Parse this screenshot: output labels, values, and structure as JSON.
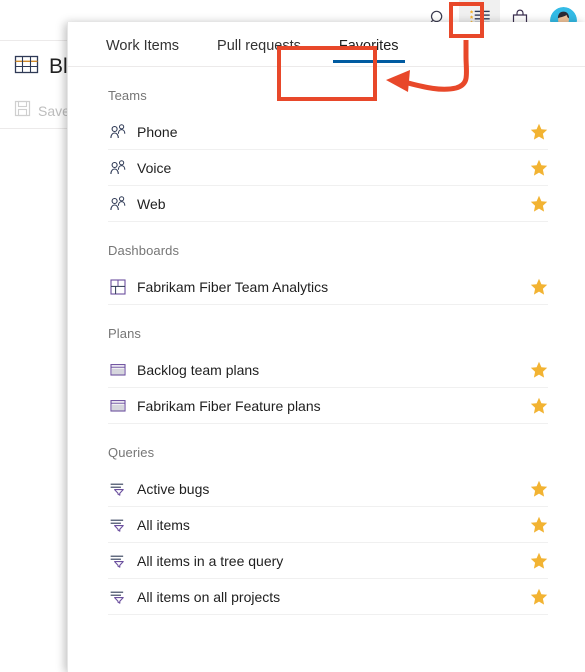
{
  "app": {
    "background": {
      "page_title": "Blocked",
      "page_title_icon": "table-icon",
      "save_label": "Save",
      "save_icon": "save-disk-icon"
    },
    "top_bar": {
      "actions": [
        {
          "name": "search-icon",
          "label": "Search"
        },
        {
          "name": "favorites-list-icon",
          "label": "Favorites"
        },
        {
          "name": "marketplace-bag-icon",
          "label": "Marketplace"
        },
        {
          "name": "user-avatar",
          "label": "User profile"
        }
      ]
    }
  },
  "flyout": {
    "tabs": [
      {
        "label": "Work Items",
        "selected": false
      },
      {
        "label": "Pull requests",
        "selected": false
      },
      {
        "label": "Favorites",
        "selected": true
      }
    ],
    "sections": [
      {
        "title": "Teams",
        "icon": "team-people-icon",
        "items": [
          {
            "label": "Phone",
            "favorited": true
          },
          {
            "label": "Voice",
            "favorited": true
          },
          {
            "label": "Web",
            "favorited": true
          }
        ]
      },
      {
        "title": "Dashboards",
        "icon": "dashboard-grid-icon",
        "items": [
          {
            "label": "Fabrikam Fiber Team Analytics",
            "favorited": true
          }
        ]
      },
      {
        "title": "Plans",
        "icon": "plan-grid-icon",
        "items": [
          {
            "label": "Backlog team plans",
            "favorited": true
          },
          {
            "label": "Fabrikam Fiber Feature plans",
            "favorited": true
          }
        ]
      },
      {
        "title": "Queries",
        "icon": "query-filter-icon",
        "items": [
          {
            "label": "Active bugs",
            "favorited": true
          },
          {
            "label": "All items",
            "favorited": true
          },
          {
            "label": "All items in a tree query",
            "favorited": true
          },
          {
            "label": "All items on all projects",
            "favorited": true
          }
        ]
      }
    ]
  },
  "annotations": {
    "color": "#e8482a",
    "arrow_from": "favorites-list-icon",
    "arrow_to": "tab-favorites",
    "highlights": [
      "favorites-list-icon",
      "tab-favorites"
    ]
  },
  "colors": {
    "accent_tab_underline": "#005ba1",
    "star_gold": "#f2b332",
    "annotation_red": "#e8482a",
    "text_primary": "#1f1f1f",
    "text_secondary": "#767676"
  }
}
